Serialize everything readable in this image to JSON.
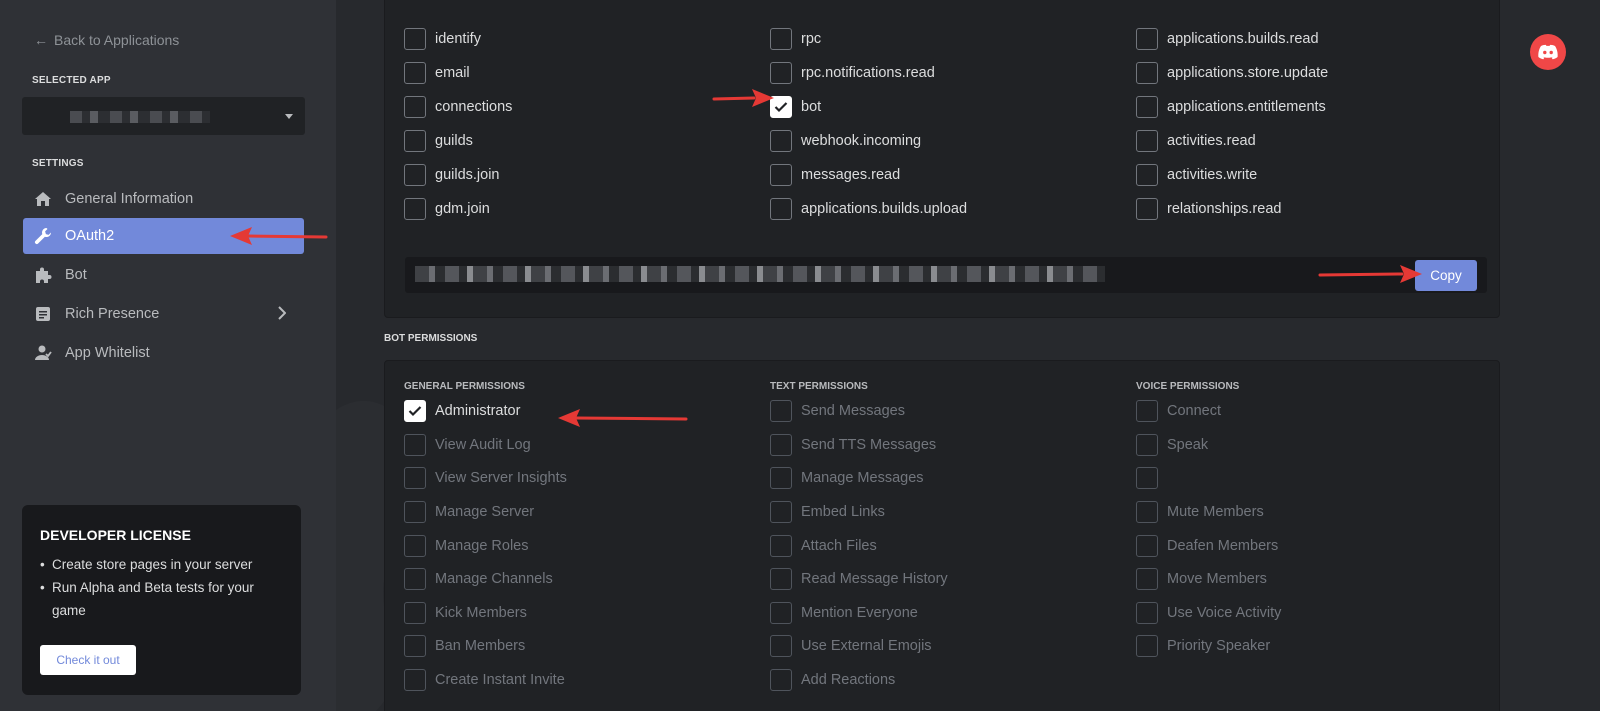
{
  "sidebar": {
    "back_label": "Back to Applications",
    "selected_app_label": "SELECTED APP",
    "settings_label": "SETTINGS",
    "items": [
      {
        "label": "General Information",
        "icon": "home-icon"
      },
      {
        "label": "OAuth2",
        "icon": "wrench-icon"
      },
      {
        "label": "Bot",
        "icon": "puzzle-icon"
      },
      {
        "label": "Rich Presence",
        "icon": "document-icon"
      },
      {
        "label": "App Whitelist",
        "icon": "user-icon"
      }
    ],
    "dev_card": {
      "title": "DEVELOPER LICENSE",
      "bullets": [
        "Create store pages in your server",
        "Run Alpha and Beta tests for your game"
      ],
      "cta": "Check it out"
    }
  },
  "scopes": {
    "col1": [
      {
        "label": "identify",
        "checked": false
      },
      {
        "label": "email",
        "checked": false
      },
      {
        "label": "connections",
        "checked": false
      },
      {
        "label": "guilds",
        "checked": false
      },
      {
        "label": "guilds.join",
        "checked": false
      },
      {
        "label": "gdm.join",
        "checked": false
      }
    ],
    "col2": [
      {
        "label": "rpc",
        "checked": false
      },
      {
        "label": "rpc.notifications.read",
        "checked": false
      },
      {
        "label": "bot",
        "checked": true
      },
      {
        "label": "webhook.incoming",
        "checked": false
      },
      {
        "label": "messages.read",
        "checked": false
      },
      {
        "label": "applications.builds.upload",
        "checked": false
      }
    ],
    "col3": [
      {
        "label": "applications.builds.read",
        "checked": false
      },
      {
        "label": "applications.store.update",
        "checked": false
      },
      {
        "label": "applications.entitlements",
        "checked": false
      },
      {
        "label": "activities.read",
        "checked": false
      },
      {
        "label": "activities.write",
        "checked": false
      },
      {
        "label": "relationships.read",
        "checked": false
      }
    ],
    "copy_label": "Copy"
  },
  "bot_permissions": {
    "label": "BOT PERMISSIONS",
    "general": {
      "header": "GENERAL PERMISSIONS",
      "items": [
        {
          "label": "Administrator",
          "checked": true
        },
        {
          "label": "View Audit Log",
          "checked": false
        },
        {
          "label": "View Server Insights",
          "checked": false
        },
        {
          "label": "Manage Server",
          "checked": false
        },
        {
          "label": "Manage Roles",
          "checked": false
        },
        {
          "label": "Manage Channels",
          "checked": false
        },
        {
          "label": "Kick Members",
          "checked": false
        },
        {
          "label": "Ban Members",
          "checked": false
        },
        {
          "label": "Create Instant Invite",
          "checked": false
        }
      ]
    },
    "text": {
      "header": "TEXT PERMISSIONS",
      "items": [
        {
          "label": "Send Messages",
          "checked": false
        },
        {
          "label": "Send TTS Messages",
          "checked": false
        },
        {
          "label": "Manage Messages",
          "checked": false
        },
        {
          "label": "Embed Links",
          "checked": false
        },
        {
          "label": "Attach Files",
          "checked": false
        },
        {
          "label": "Read Message History",
          "checked": false
        },
        {
          "label": "Mention Everyone",
          "checked": false
        },
        {
          "label": "Use External Emojis",
          "checked": false
        },
        {
          "label": "Add Reactions",
          "checked": false
        }
      ]
    },
    "voice": {
      "header": "VOICE PERMISSIONS",
      "items": [
        {
          "label": "Connect",
          "checked": false
        },
        {
          "label": "Speak",
          "checked": false
        },
        {
          "label": "",
          "checked": false
        },
        {
          "label": "Mute Members",
          "checked": false
        },
        {
          "label": "Deafen Members",
          "checked": false
        },
        {
          "label": "Move Members",
          "checked": false
        },
        {
          "label": "Use Voice Activity",
          "checked": false
        },
        {
          "label": "Priority Speaker",
          "checked": false
        }
      ]
    }
  },
  "colors": {
    "accent": "#7289da",
    "arrow": "#e53935",
    "logo": "#f04747"
  }
}
